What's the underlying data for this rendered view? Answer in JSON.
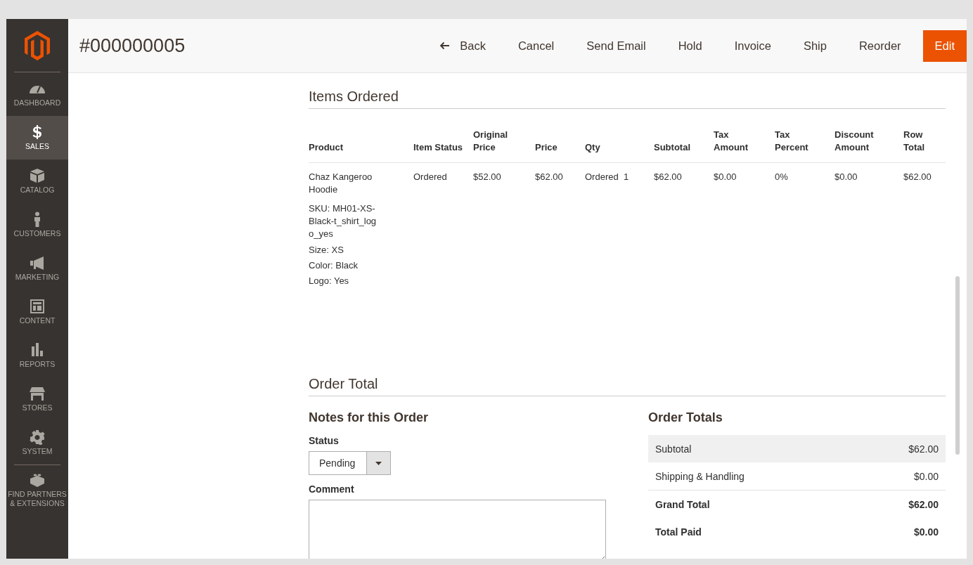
{
  "sidebar": {
    "items": [
      {
        "label": "DASHBOARD",
        "selected": false
      },
      {
        "label": "SALES",
        "selected": true
      },
      {
        "label": "CATALOG",
        "selected": false
      },
      {
        "label": "CUSTOMERS",
        "selected": false
      },
      {
        "label": "MARKETING",
        "selected": false
      },
      {
        "label": "CONTENT",
        "selected": false
      },
      {
        "label": "REPORTS",
        "selected": false
      },
      {
        "label": "STORES",
        "selected": false
      },
      {
        "label": "SYSTEM",
        "selected": false
      },
      {
        "label": "FIND PARTNERS & EXTENSIONS",
        "selected": false
      }
    ]
  },
  "header": {
    "title": "#000000005",
    "actions": [
      {
        "label": "Back",
        "kind": "back"
      },
      {
        "label": "Cancel",
        "kind": "text"
      },
      {
        "label": "Send Email",
        "kind": "text"
      },
      {
        "label": "Hold",
        "kind": "text"
      },
      {
        "label": "Invoice",
        "kind": "text"
      },
      {
        "label": "Ship",
        "kind": "text"
      },
      {
        "label": "Reorder",
        "kind": "text"
      },
      {
        "label": "Edit",
        "kind": "primary"
      }
    ]
  },
  "items_ordered": {
    "title": "Items Ordered",
    "columns": [
      "Product",
      "Item Status",
      "Original Price",
      "Price",
      "Qty",
      "Subtotal",
      "Tax Amount",
      "Tax Percent",
      "Discount Amount",
      "Row Total"
    ],
    "rows": [
      {
        "product": {
          "name": "Chaz Kangeroo Hoodie",
          "sku": "SKU: MH01-XS-Black-t_shirt_logo_yes",
          "options": [
            {
              "label": "Size:",
              "value": "XS"
            },
            {
              "label": "Color:",
              "value": "Black"
            },
            {
              "label": "Logo:",
              "value": "Yes"
            }
          ]
        },
        "item_status": "Ordered",
        "original_price": "$52.00",
        "price": "$62.00",
        "qty_label": "Ordered",
        "qty": "1",
        "subtotal": "$62.00",
        "tax_amount": "$0.00",
        "tax_percent": "0%",
        "discount_amount": "$0.00",
        "row_total": "$62.00"
      }
    ]
  },
  "order_total": {
    "title": "Order Total",
    "notes": {
      "title": "Notes for this Order",
      "status_label": "Status",
      "status_value": "Pending",
      "comment_label": "Comment"
    },
    "totals": {
      "title": "Order Totals",
      "rows": [
        {
          "label": "Subtotal",
          "value": "$62.00",
          "kind": "plain",
          "highlighted": true
        },
        {
          "label": "Shipping & Handling",
          "value": "$0.00",
          "kind": "plain",
          "highlighted": false
        },
        {
          "label": "Grand Total",
          "value": "$62.00",
          "kind": "bold",
          "highlighted": false
        },
        {
          "label": "Total Paid",
          "value": "$0.00",
          "kind": "bold",
          "highlighted": false
        }
      ]
    }
  }
}
